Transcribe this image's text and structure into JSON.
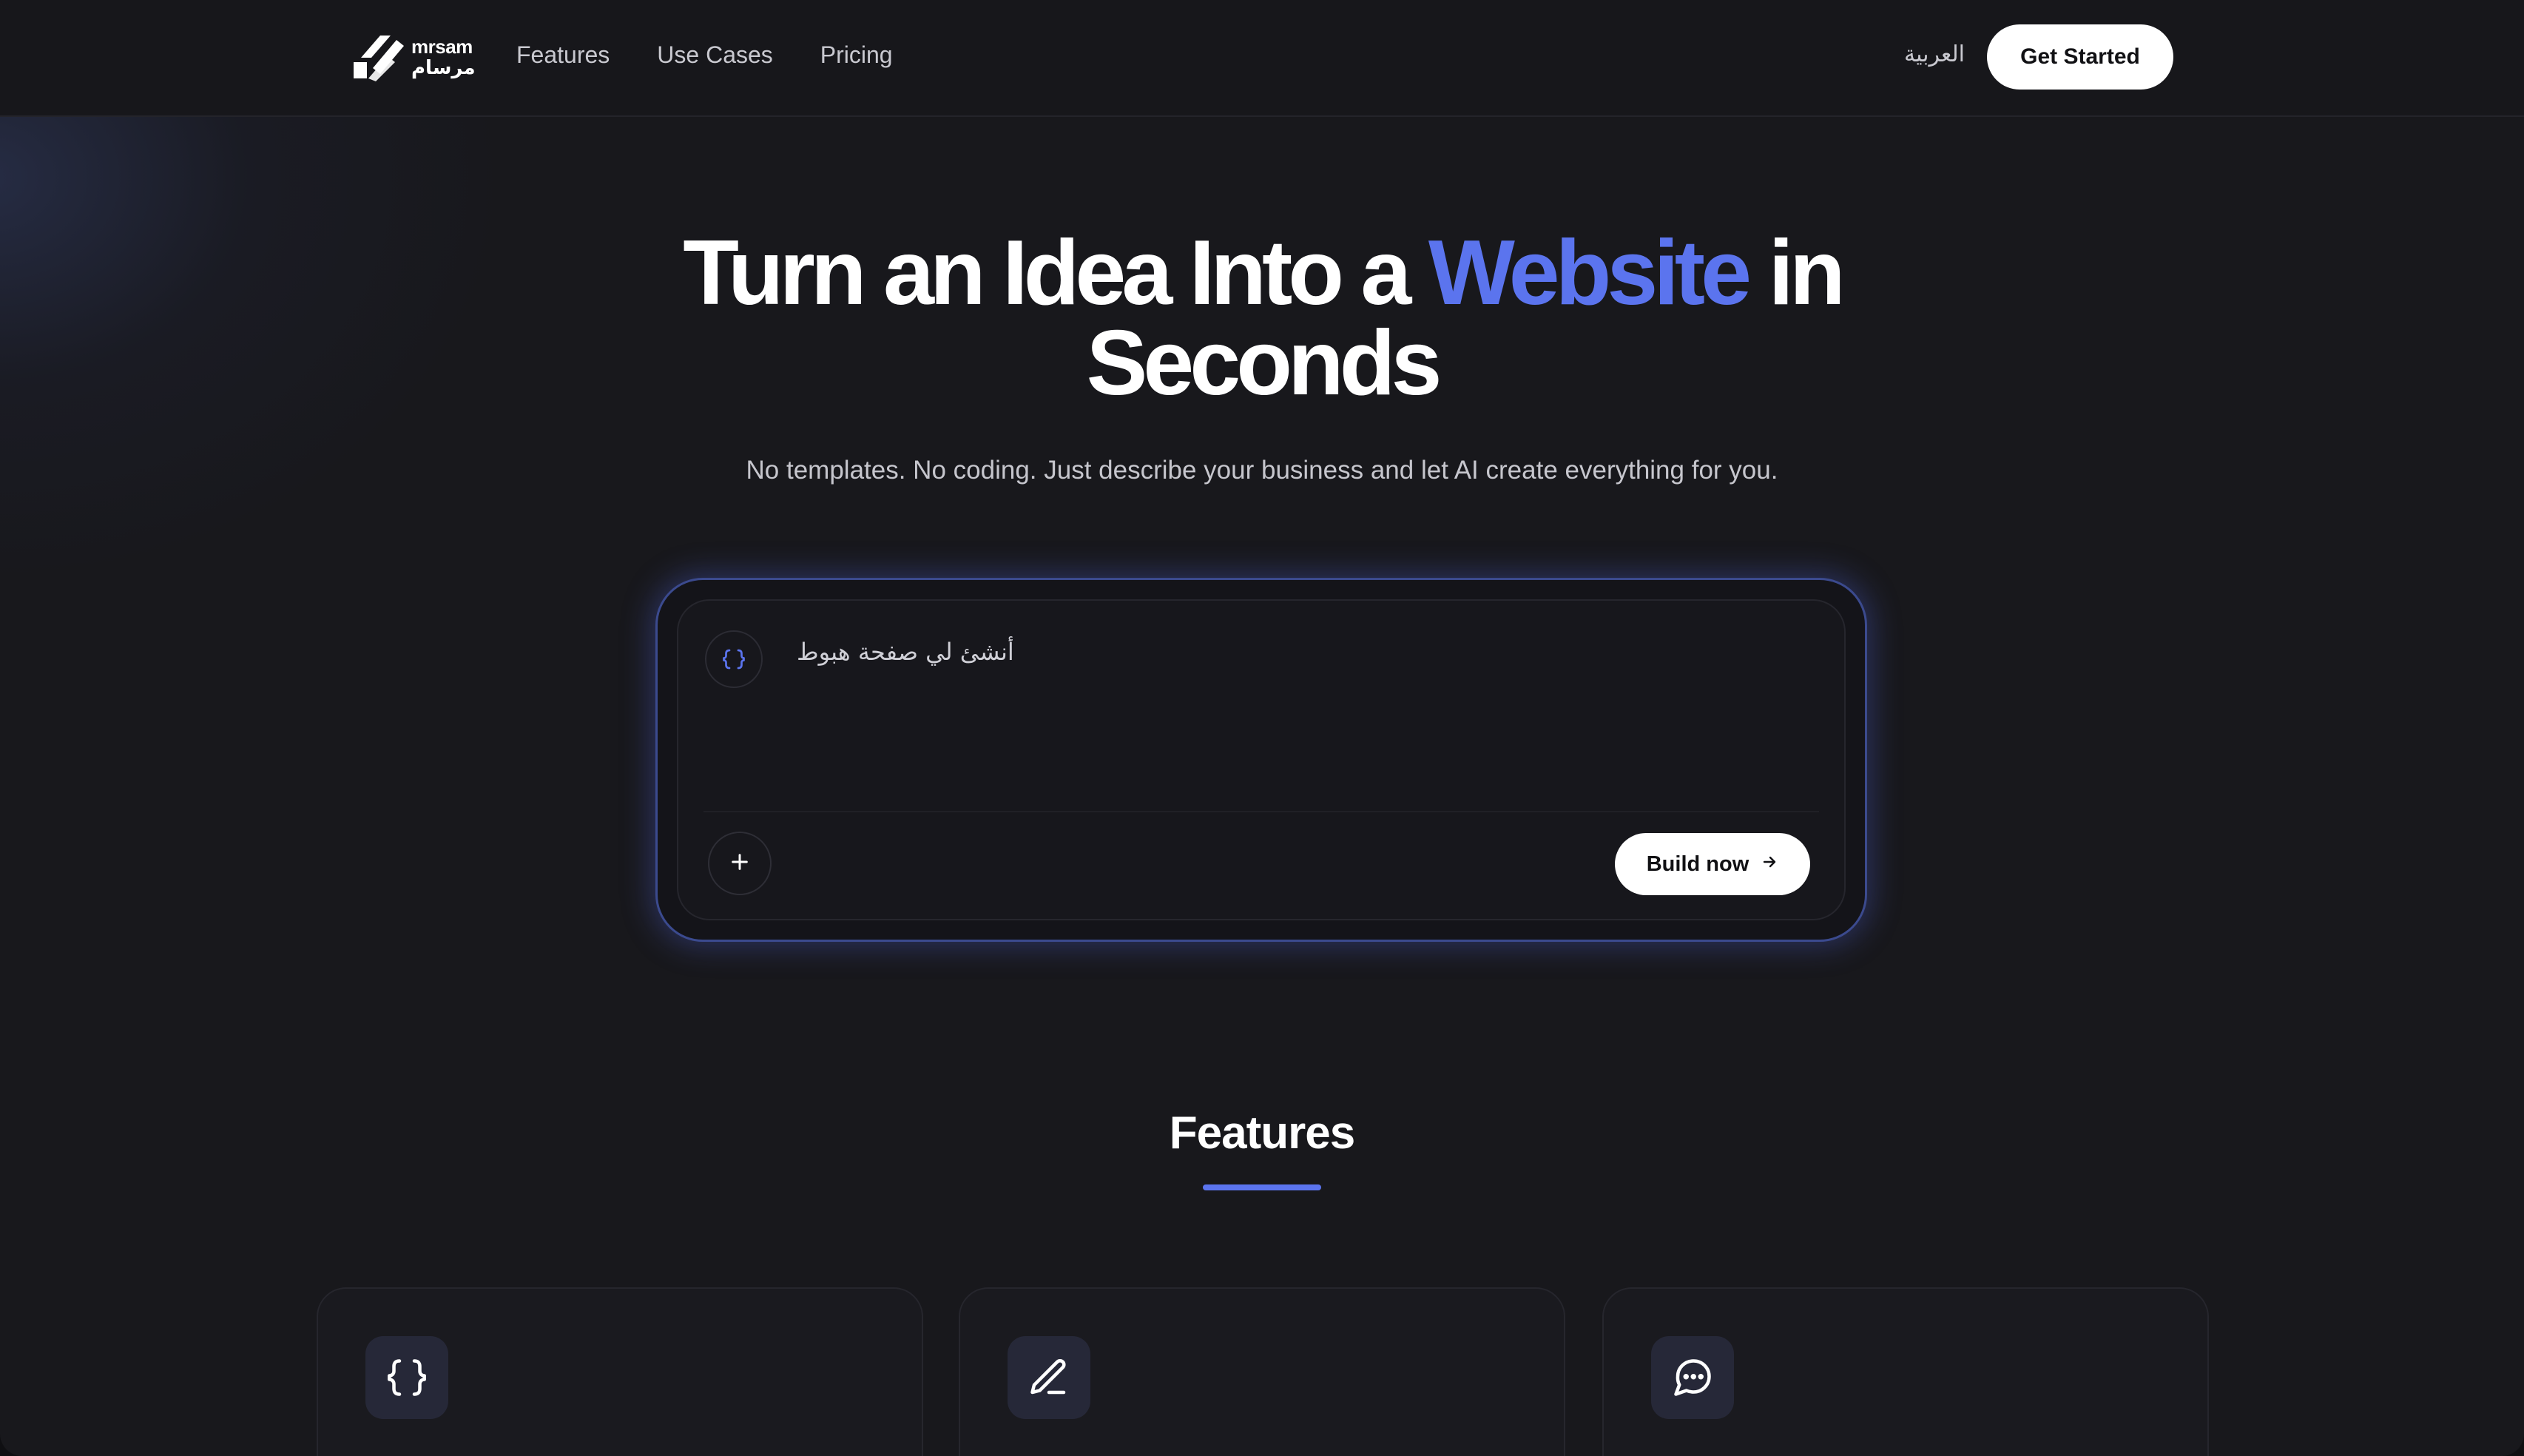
{
  "brand": {
    "logo_en": "mrsam",
    "logo_ar": "مرسام"
  },
  "nav": {
    "items": [
      {
        "label": "Features"
      },
      {
        "label": "Use Cases"
      },
      {
        "label": "Pricing"
      }
    ],
    "language_toggle": "العربية",
    "cta_label": "Get Started"
  },
  "hero": {
    "title_part1": "Turn an Idea Into a ",
    "title_accent": "Website",
    "title_part2": " in Seconds",
    "subtitle": "No templates. No coding. Just describe your business and let AI create everything for you."
  },
  "prompt": {
    "text": "أنشئ لي صفحة هبوط",
    "prompt_icon": "code-braces-icon",
    "attach_icon": "plus-icon",
    "build_label": "Build now",
    "build_icon": "arrow-right-icon"
  },
  "features": {
    "heading": "Features",
    "cards": [
      {
        "icon": "code-braces-icon"
      },
      {
        "icon": "pen-icon"
      },
      {
        "icon": "chat-bubble-icon"
      }
    ]
  },
  "colors": {
    "accent": "#5b74ee",
    "background": "#18181c",
    "button_bg": "#ffffff"
  }
}
